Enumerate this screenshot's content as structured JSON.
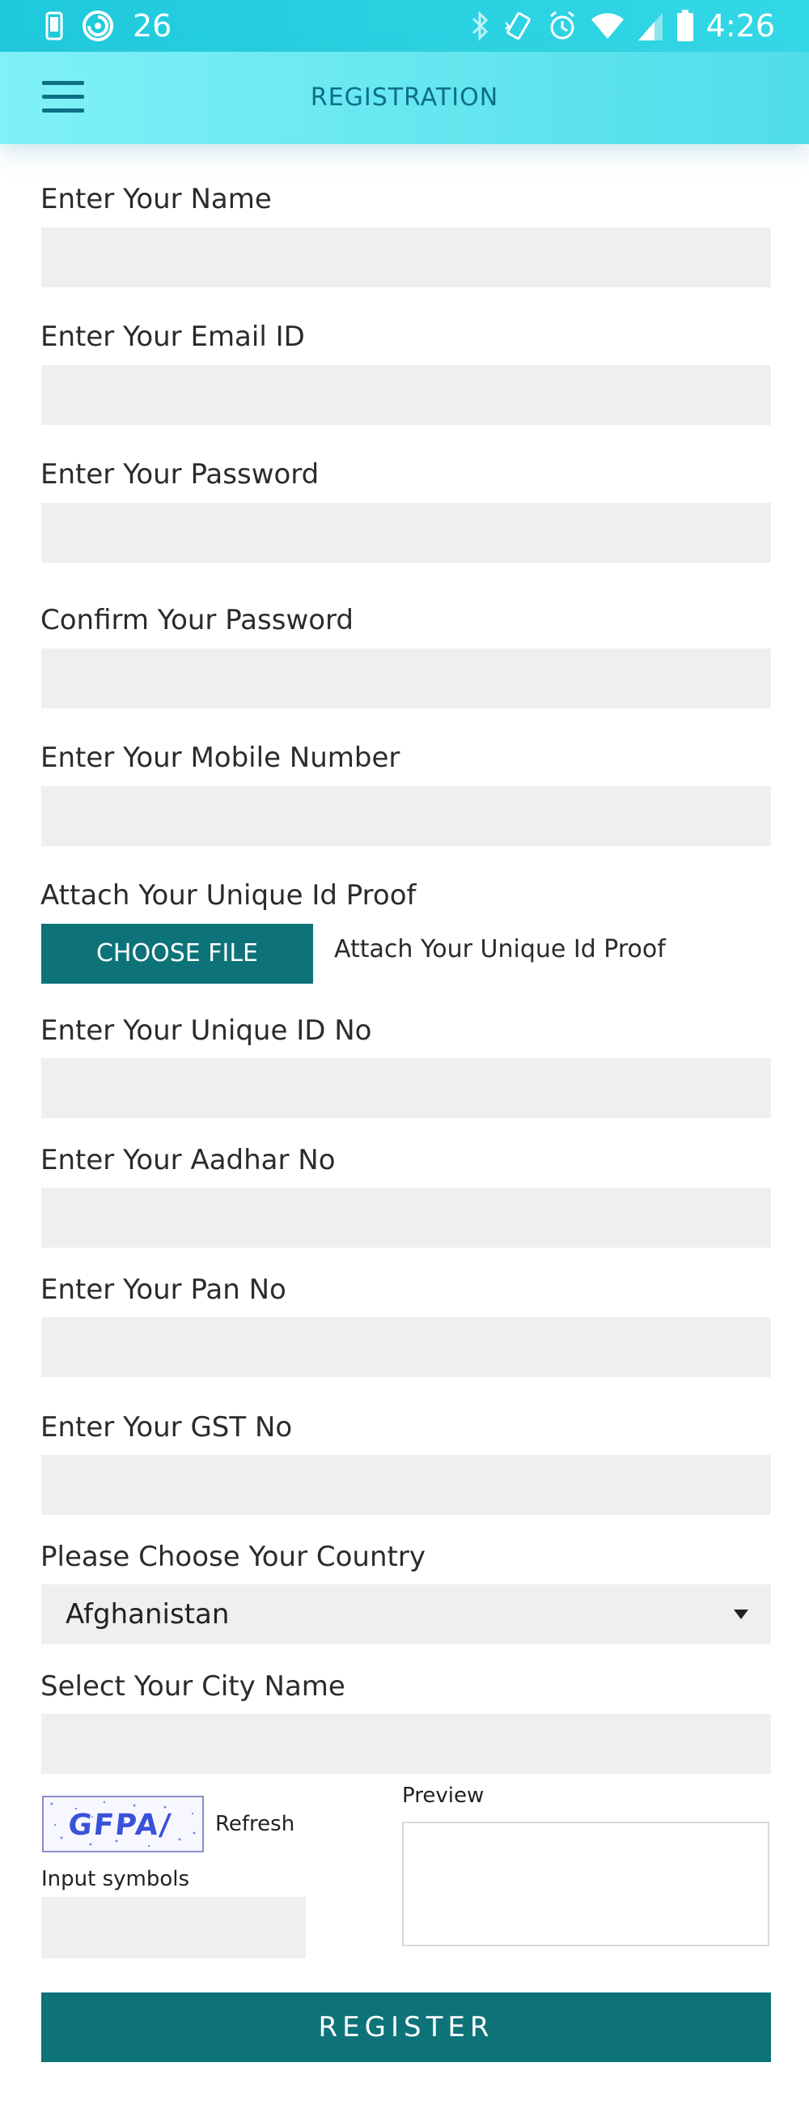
{
  "status_bar": {
    "notification_count": "26",
    "time": "4:26"
  },
  "app_bar": {
    "title": "REGISTRATION",
    "menu_icon": "hamburger-menu-icon"
  },
  "form": {
    "name_label": "Enter Your Name",
    "email_label": "Enter Your Email ID",
    "password_label": "Enter Your Password",
    "confirm_password_label": "Confirm Your Password",
    "mobile_label": "Enter Your Mobile Number",
    "id_proof_label": "Attach Your Unique Id Proof",
    "choose_file_label": "CHOOSE FILE",
    "id_proof_note": "Attach Your Unique Id Proof",
    "unique_id_label": "Enter Your Unique ID No",
    "aadhar_label": "Enter Your Aadhar No",
    "pan_label": "Enter Your Pan No",
    "gst_label": "Enter Your GST No",
    "country_label": "Please Choose Your Country",
    "country_value": "Afghanistan",
    "city_label": "Select Your City Name",
    "captcha_text": "GFPA/",
    "refresh_label": "Refresh",
    "preview_label": "Preview",
    "input_symbols_label": "Input symbols",
    "register_label": "REGISTER"
  },
  "colors": {
    "status_bar": "#1ec9db",
    "app_bar": "#63e6f0",
    "title_text": "#0c6f87",
    "button": "#0d7379",
    "input_bg": "#efefef"
  }
}
